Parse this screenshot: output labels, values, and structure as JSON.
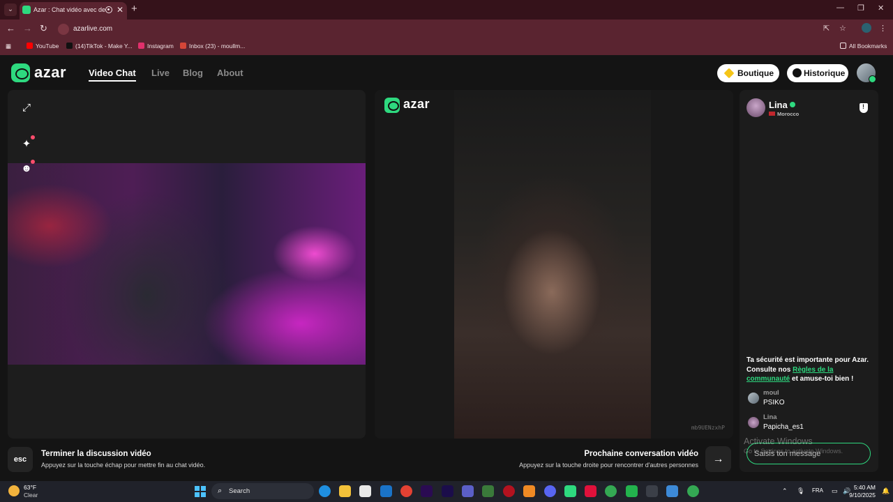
{
  "browser": {
    "tab_title": "Azar : Chat vidéo avec de n",
    "tab_close": "✕",
    "new_tab": "+",
    "url": "azarlive.com",
    "bookmarks": [
      {
        "label": "YouTube",
        "color": "#ff0000"
      },
      {
        "label": "(14)TikTok - Make Y...",
        "color": "#111111"
      },
      {
        "label": "Instagram",
        "color": "#e1306c"
      },
      {
        "label": "Inbox (23) - moullm...",
        "color": "#d44638"
      }
    ],
    "all_bookmarks": "All Bookmarks"
  },
  "site": {
    "logo_text": "azar",
    "nav": [
      "Video Chat",
      "Live",
      "Blog",
      "About"
    ],
    "active_nav": "Video Chat",
    "boutique_label": "Boutique",
    "historique_label": "Historique"
  },
  "video": {
    "remote_id": "mb9UENzxhP"
  },
  "chat": {
    "partner_name": "Lina",
    "partner_country": "Morocco",
    "safety_prefix": "Ta sécurité est importante pour Azar. Consulte nos ",
    "safety_link": "Règles de la communauté",
    "safety_suffix": " et amuse-toi bien !",
    "messages": [
      {
        "user": "moul",
        "text": "PSIKO"
      },
      {
        "user": "Lina",
        "text": "Papicha_es1"
      }
    ],
    "input_placeholder": "Saisis ton message"
  },
  "watermark": {
    "title": "Activate Windows",
    "subtitle": "Go to Settings to activate Windows."
  },
  "controls": {
    "esc_key": "esc",
    "end_title": "Terminer la discussion vidéo",
    "end_sub": "Appuyez sur la touche échap pour mettre fin au chat vidéo.",
    "next_title": "Prochaine conversation vidéo",
    "next_sub": "Appuyez sur la touche droite pour rencontrer d'autres personnes"
  },
  "taskbar": {
    "temperature": "63°F",
    "condition": "Clear",
    "search_label": "Search",
    "language": "FRA",
    "time": "5:40 AM",
    "date": "9/10/2025"
  },
  "colors": {
    "accent": "#2ed97f",
    "browser_frame": "#5a2430"
  }
}
